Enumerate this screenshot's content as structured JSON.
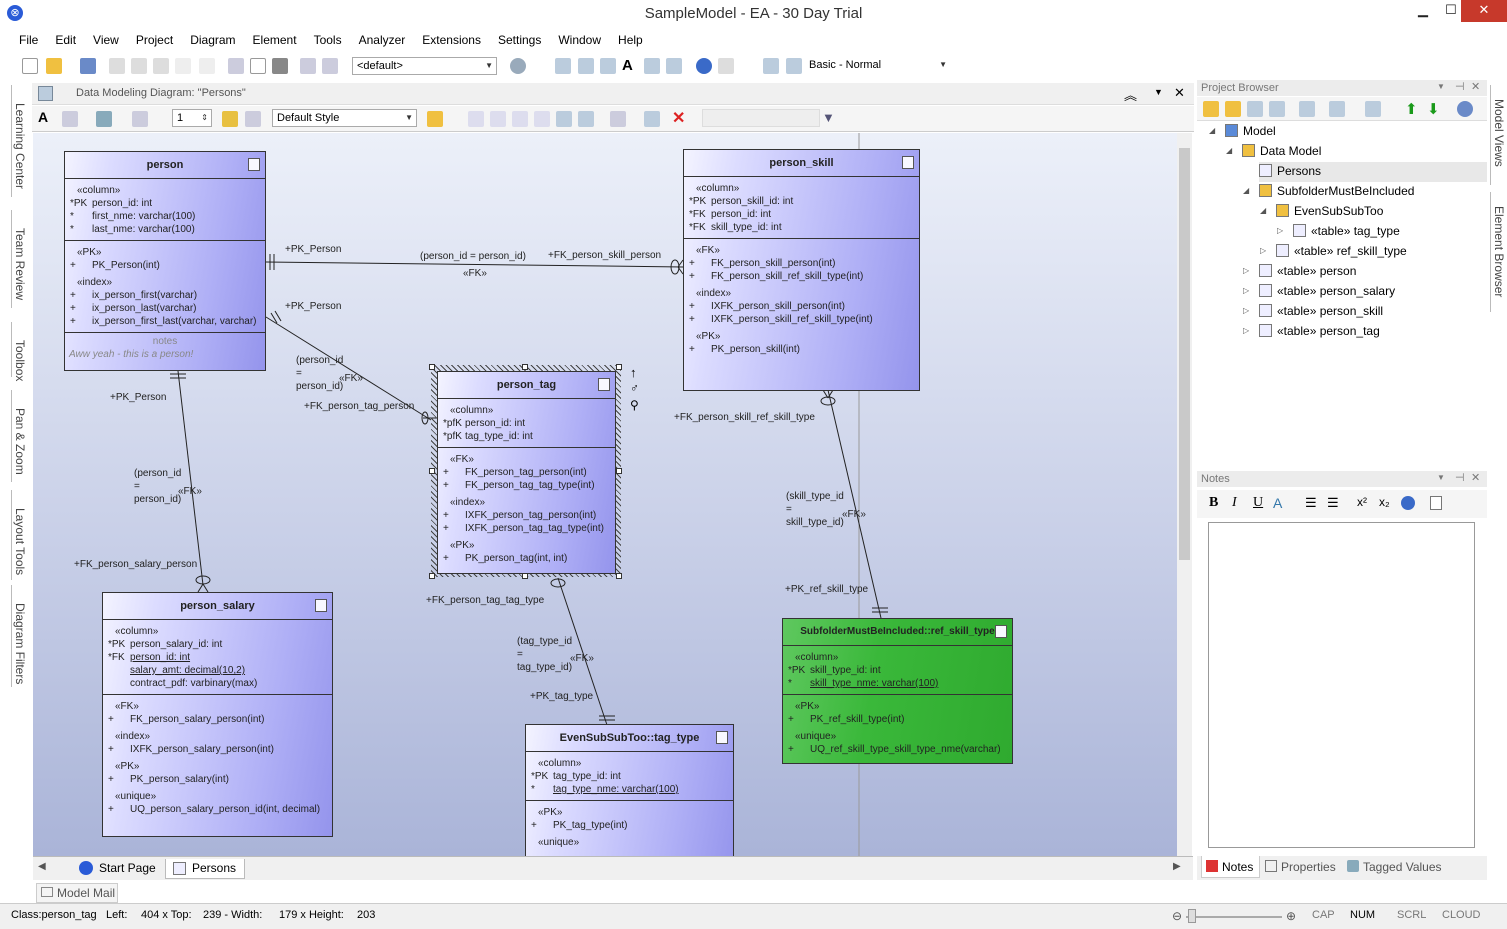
{
  "window": {
    "title": "SampleModel - EA - 30 Day Trial",
    "min": "▁",
    "max": "☐",
    "close": "✕"
  },
  "menu": [
    "File",
    "Edit",
    "View",
    "Project",
    "Diagram",
    "Element",
    "Tools",
    "Analyzer",
    "Extensions",
    "Settings",
    "Window",
    "Help"
  ],
  "toolbar": {
    "perspective": "<default>",
    "workspace": "Basic - Normal"
  },
  "left_tabs": [
    "Learning Center",
    "Team Review",
    "Toolbox",
    "Pan & Zoom",
    "Layout Tools",
    "Diagram Filters"
  ],
  "diagram": {
    "title": "Data Modeling Diagram: \"Persons\"",
    "style": "Default Style",
    "line_width": "1"
  },
  "entities": {
    "person": {
      "name": "person",
      "columns_st": "«column»",
      "columns": [
        {
          "s": "*PK",
          "t": "person_id: int"
        },
        {
          "s": "*",
          "t": "first_nme: varchar(100)"
        },
        {
          "s": "*",
          "t": "last_nme: varchar(100)"
        }
      ],
      "pk_st": "«PK»",
      "pk": [
        {
          "s": "+",
          "t": "PK_Person(int)"
        }
      ],
      "idx_st": "«index»",
      "idx": [
        {
          "s": "+",
          "t": "ix_person_first(varchar)"
        },
        {
          "s": "+",
          "t": "ix_person_last(varchar)"
        },
        {
          "s": "+",
          "t": "ix_person_first_last(varchar, varchar)"
        }
      ],
      "notes_label": "notes",
      "notes": "Aww yeah - this is a person!"
    },
    "person_skill": {
      "name": "person_skill",
      "columns_st": "«column»",
      "columns": [
        {
          "s": "*PK",
          "t": "person_skill_id: int"
        },
        {
          "s": "*FK",
          "t": "person_id: int"
        },
        {
          "s": "*FK",
          "t": "skill_type_id: int"
        }
      ],
      "fk_st": "«FK»",
      "fk": [
        {
          "s": "+",
          "t": "FK_person_skill_person(int)"
        },
        {
          "s": "+",
          "t": "FK_person_skill_ref_skill_type(int)"
        }
      ],
      "idx_st": "«index»",
      "idx": [
        {
          "s": "+",
          "t": "IXFK_person_skill_person(int)"
        },
        {
          "s": "+",
          "t": "IXFK_person_skill_ref_skill_type(int)"
        }
      ],
      "pk_st": "«PK»",
      "pk": [
        {
          "s": "+",
          "t": "PK_person_skill(int)"
        }
      ]
    },
    "person_tag": {
      "name": "person_tag",
      "columns_st": "«column»",
      "columns": [
        {
          "s": "*pfK",
          "t": "person_id: int"
        },
        {
          "s": "*pfK",
          "t": "tag_type_id: int"
        }
      ],
      "fk_st": "«FK»",
      "fk": [
        {
          "s": "+",
          "t": "FK_person_tag_person(int)"
        },
        {
          "s": "+",
          "t": "FK_person_tag_tag_type(int)"
        }
      ],
      "idx_st": "«index»",
      "idx": [
        {
          "s": "+",
          "t": "IXFK_person_tag_person(int)"
        },
        {
          "s": "+",
          "t": "IXFK_person_tag_tag_type(int)"
        }
      ],
      "pk_st": "«PK»",
      "pk": [
        {
          "s": "+",
          "t": "PK_person_tag(int, int)"
        }
      ]
    },
    "person_salary": {
      "name": "person_salary",
      "columns_st": "«column»",
      "columns": [
        {
          "s": "*PK",
          "t": "person_salary_id: int"
        },
        {
          "s": "*FK",
          "t": "person_id: int"
        },
        {
          "s": "",
          "t": "salary_amt: decimal(10,2)"
        },
        {
          "s": "",
          "t": "contract_pdf: varbinary(max)"
        }
      ],
      "fk_st": "«FK»",
      "fk": [
        {
          "s": "+",
          "t": "FK_person_salary_person(int)"
        }
      ],
      "idx_st": "«index»",
      "idx": [
        {
          "s": "+",
          "t": "IXFK_person_salary_person(int)"
        }
      ],
      "pk_st": "«PK»",
      "pk": [
        {
          "s": "+",
          "t": "PK_person_salary(int)"
        }
      ],
      "uq_st": "«unique»",
      "uq": [
        {
          "s": "+",
          "t": "UQ_person_salary_person_id(int, decimal)"
        }
      ]
    },
    "ref_skill_type": {
      "name": "SubfolderMustBeIncluded::ref_skill_type",
      "columns_st": "«column»",
      "columns": [
        {
          "s": "*PK",
          "t": "skill_type_id: int"
        },
        {
          "s": "*",
          "t": "skill_type_nme: varchar(100)"
        }
      ],
      "pk_st": "«PK»",
      "pk": [
        {
          "s": "+",
          "t": "PK_ref_skill_type(int)"
        }
      ],
      "uq_st": "«unique»",
      "uq": [
        {
          "s": "+",
          "t": "UQ_ref_skill_type_skill_type_nme(varchar)"
        }
      ]
    },
    "tag_type": {
      "name": "EvenSubSubToo::tag_type",
      "columns_st": "«column»",
      "columns": [
        {
          "s": "*PK",
          "t": "tag_type_id: int"
        },
        {
          "s": "*",
          "t": "tag_type_nme: varchar(100)"
        }
      ],
      "pk_st": "«PK»",
      "pk": [
        {
          "s": "+",
          "t": "PK_tag_type(int)"
        }
      ],
      "uq_st": "«unique»"
    }
  },
  "relations": {
    "r1_src": "+PK_Person",
    "r1_cond": "(person_id = person_id)",
    "r1_fk": "«FK»",
    "r1_dst": "+FK_person_skill_person",
    "r2_src": "+PK_Person",
    "r2_cond1": "(person_id",
    "r2_cond2": "=",
    "r2_cond3": "person_id)",
    "r2_fk": "«FK»",
    "r2_dst": "+FK_person_tag_person",
    "r3_src": "+PK_Person",
    "r3_cond1": "(person_id",
    "r3_cond2": "=",
    "r3_cond3": "person_id)",
    "r3_fk": "«FK»",
    "r3_dst": "+FK_person_salary_person",
    "r4_src": "+FK_person_skill_ref_skill_type",
    "r4_cond1": "(skill_type_id",
    "r4_cond2": "=",
    "r4_cond3": "skill_type_id)",
    "r4_fk": "«FK»",
    "r4_dst": "+PK_ref_skill_type",
    "r5_src": "+FK_person_tag_tag_type",
    "r5_cond1": "(tag_type_id",
    "r5_cond2": "=",
    "r5_cond3": "tag_type_id)",
    "r5_fk": "«FK»",
    "r5_dst": "+PK_tag_type"
  },
  "tabs": {
    "start": "Start Page",
    "persons": "Persons",
    "mail": "Model Mail"
  },
  "project_browser": {
    "title": "Project Browser",
    "nodes": [
      "Model",
      "Data Model",
      "Persons",
      "SubfolderMustBeIncluded",
      "EvenSubSubToo",
      "«table» tag_type",
      "«table» ref_skill_type",
      "«table» person",
      "«table» person_salary",
      "«table» person_skill",
      "«table» person_tag"
    ]
  },
  "right_tabs": [
    "Model Views",
    "Element Browser"
  ],
  "notes_panel": {
    "title": "Notes",
    "tabs": [
      "Notes",
      "Properties",
      "Tagged Values"
    ]
  },
  "status": {
    "class": "Class:person_tag",
    "left": "Left:",
    "left_v": "404 x Top:",
    "top_v": "239 - Width:",
    "width_v": "179 x Height:",
    "height_v": "203",
    "ind": [
      "CAP",
      "NUM",
      "SCRL",
      "CLOUD"
    ]
  }
}
